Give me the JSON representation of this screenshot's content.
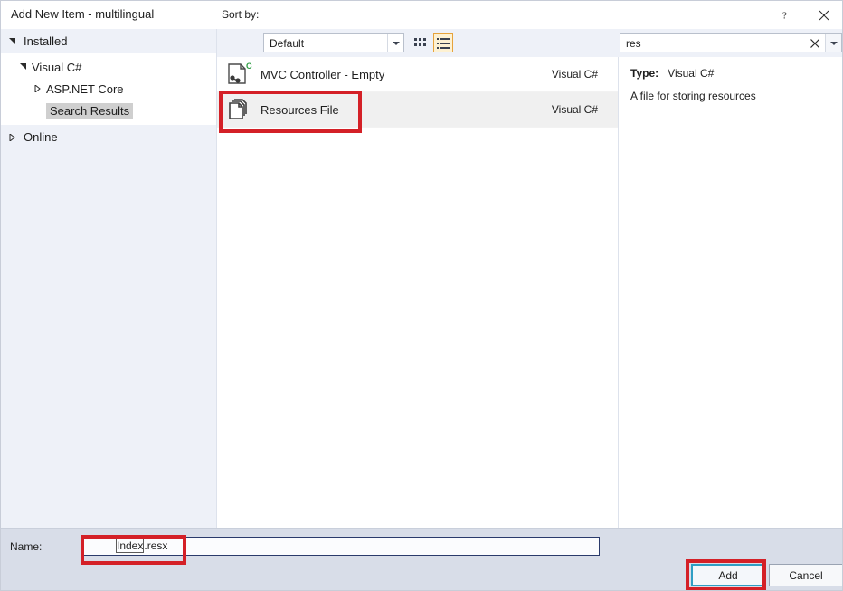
{
  "window": {
    "title": "Add New Item - multilingual",
    "help_icon": "question-mark-icon",
    "close_icon": "close-icon"
  },
  "toolbar": {
    "sort_label": "Sort by:",
    "sort_value": "Default",
    "grid_view_icon": "grid-view-icon",
    "list_view_icon": "list-view-icon",
    "list_view_selected": true,
    "accent_selected": "#e6a33c",
    "accent_selected_bg": "#fdf1d2"
  },
  "search": {
    "value": "res",
    "clear_icon": "clear-x-icon",
    "dropdown_icon": "chevron-down-icon"
  },
  "sidebar": {
    "installed": {
      "label": "Installed",
      "expanded": true,
      "nodes": [
        {
          "label": "Visual C#",
          "expanded": true,
          "level": 1
        },
        {
          "label": "ASP.NET Core",
          "expanded": false,
          "level": 2
        },
        {
          "label": "Search Results",
          "expanded": null,
          "level": 2,
          "selected": true
        }
      ]
    },
    "online": {
      "label": "Online",
      "expanded": false
    }
  },
  "list": {
    "items": [
      {
        "name": "MVC Controller - Empty",
        "language": "Visual C#",
        "icon": "csharp-controller-icon",
        "selected": false
      },
      {
        "name": "Resources File",
        "language": "Visual C#",
        "icon": "resource-file-icon",
        "selected": true
      }
    ]
  },
  "details": {
    "type_label": "Type:",
    "type_value": "Visual C#",
    "description": "A file for storing resources"
  },
  "footer": {
    "name_label": "Name:",
    "name_value_selected": "Index",
    "name_value_rest": ".resx",
    "add_label": "Add",
    "cancel_label": "Cancel"
  },
  "annotations": {
    "color": "#d42027",
    "boxes": [
      "resources-file-row",
      "name-input-value",
      "add-button"
    ]
  }
}
